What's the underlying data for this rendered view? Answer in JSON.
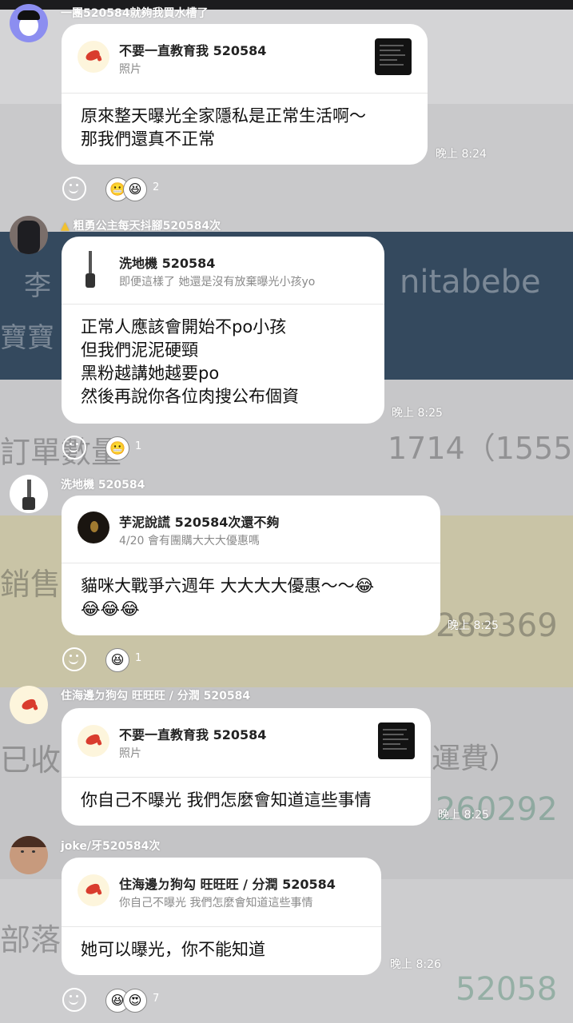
{
  "messages": [
    {
      "sender": "一團520584就夠我買水槽了",
      "reply_name": "不要一直教育我 520584",
      "reply_sub": "照片",
      "lines": [
        "原來整天曝光全家隱私是正常生活啊～",
        "那我們還真不正常"
      ],
      "time": "晚上 8:24",
      "reaction_count": "2"
    },
    {
      "sender": "粗勇公主每天抖腳520584次",
      "reply_name": "洗地機 520584",
      "reply_sub": "即便這樣了 她還是沒有放棄曝光小孩yo",
      "lines": [
        "正常人應該會開始不po小孩",
        "但我們泥泥硬頸",
        "黑粉越講她越要po",
        "然後再說你各位肉搜公布個資"
      ],
      "time": "晚上 8:25",
      "reaction_count": "1"
    },
    {
      "sender": "洗地機 520584",
      "reply_name": "芋泥說謊 520584次還不夠",
      "reply_sub": "4/20 會有團購大大大優惠嗎",
      "lines": [
        "貓咪大戰爭六週年 大大大大優惠～～😂",
        "😂😂😂"
      ],
      "time": "晚上 8:25",
      "reaction_count": "1"
    },
    {
      "sender": "住海邊ㄉ狗勾 旺旺旺 / 分潤 520584",
      "reply_name": "不要一直教育我 520584",
      "reply_sub": "照片",
      "lines": [
        "你自己不曝光 我們怎麼會知道這些事情"
      ],
      "time": "晚上 8:25"
    },
    {
      "sender": "joke/牙520584次",
      "reply_name": "住海邊ㄉ狗勾 旺旺旺 / 分潤 520584",
      "reply_sub": "你自己不曝光 我們怎麼會知道這些事情",
      "lines": [
        "她可以曝光，你不能知道"
      ],
      "time": "晚上 8:26",
      "reaction_count": "7"
    }
  ],
  "background": [
    "李",
    "nitabebe",
    "寶寶",
    "訂單數量",
    "1714（1555",
    "銷售金",
    "283369",
    "已收匯",
    "運費）",
    "260292",
    "部落客",
    "52058"
  ],
  "icons": {
    "sender_badge_2": "crown-icon",
    "react": "smile-icon",
    "reply_thumbs": [
      "sauce-logo-icon",
      "vacuum-icon",
      "dark-avatar-icon"
    ]
  },
  "colors": {
    "bubble": "#ffffff",
    "topbar": "#1c1c1e",
    "blue_band": "#34495e",
    "sauce_red": "#d93c2e"
  }
}
